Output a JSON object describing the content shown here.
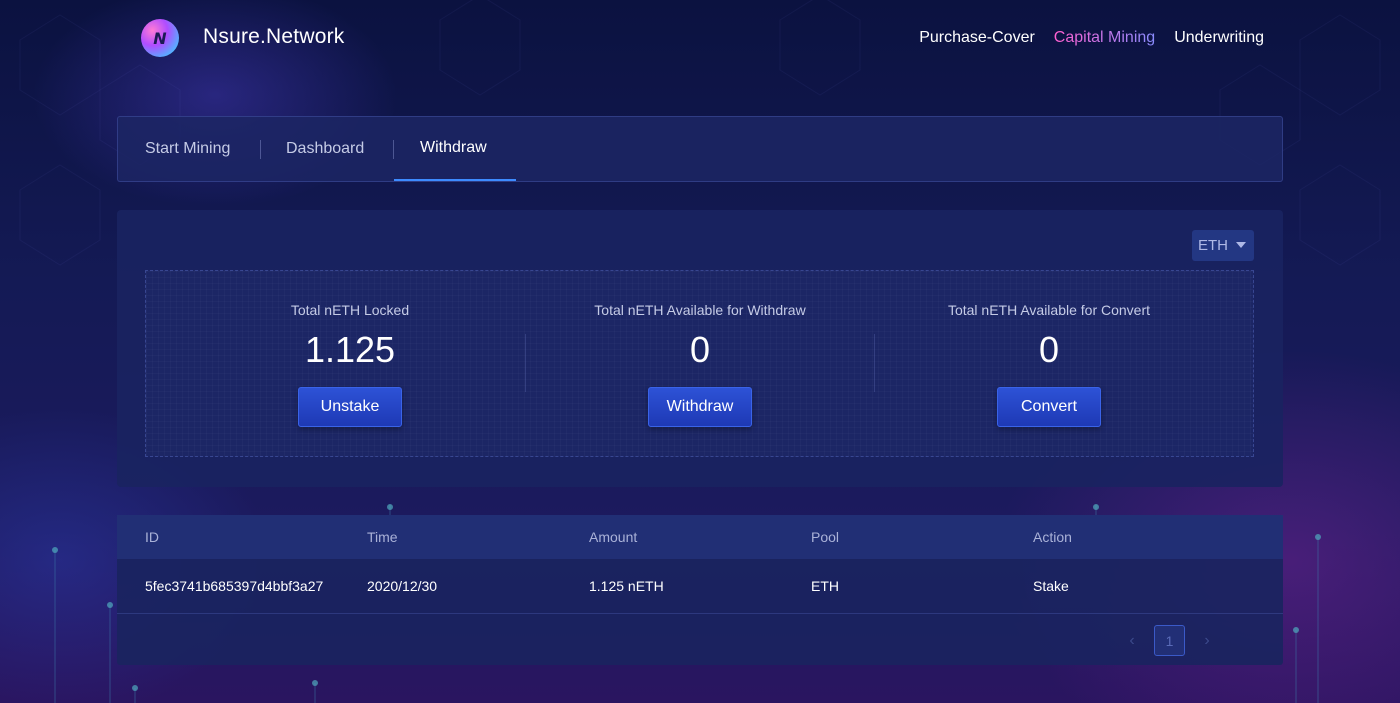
{
  "header": {
    "logo_glyph": "N",
    "brand": "Nsure.Network",
    "nav": [
      "Purchase-Cover",
      "Capital Mining",
      "Underwriting"
    ],
    "active_nav": "Capital Mining"
  },
  "tabs": {
    "items": [
      "Start Mining",
      "Dashboard",
      "Withdraw"
    ],
    "active": "Withdraw"
  },
  "token_select": {
    "value": "ETH"
  },
  "stats": [
    {
      "label": "Total nETH Locked",
      "value": "1.125",
      "button": "Unstake"
    },
    {
      "label": "Total nETH Available for Withdraw",
      "value": "0",
      "button": "Withdraw"
    },
    {
      "label": "Total nETH Available for Convert",
      "value": "0",
      "button": "Convert"
    }
  ],
  "table": {
    "columns": [
      "ID",
      "Time",
      "Amount",
      "Pool",
      "Action"
    ],
    "rows": [
      [
        "5fec3741b685397d4bbf3a27",
        "2020/12/30",
        "1.125 nETH",
        "ETH",
        "Stake"
      ]
    ]
  },
  "pagination": {
    "prev": "‹",
    "current": "1",
    "next": "›"
  },
  "colors": {
    "accent": "#3d8bff",
    "button": "#2447c6",
    "active_nav_gradient": [
      "#ff5fd0",
      "#8a8cff"
    ]
  }
}
